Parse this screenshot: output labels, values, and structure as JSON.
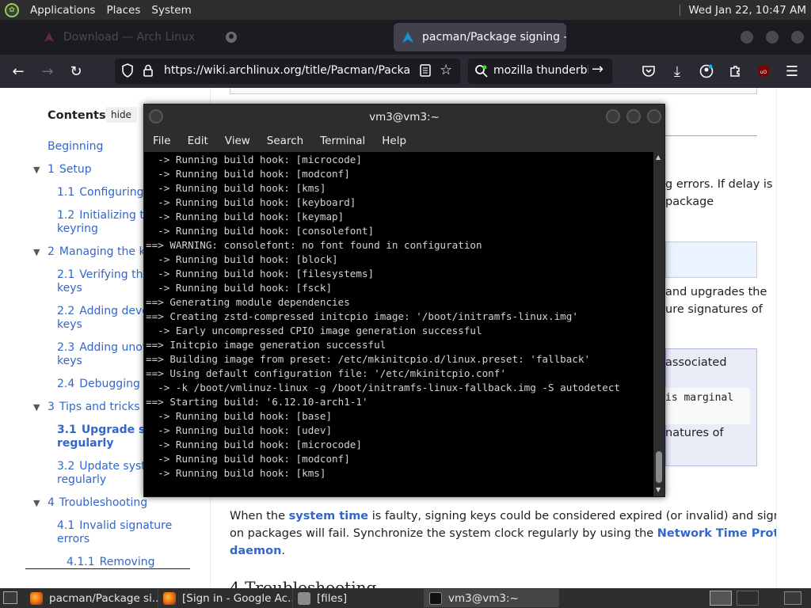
{
  "top_panel": {
    "applications": "Applications",
    "places": "Places",
    "system": "System",
    "clock": "Wed Jan 22, 10:47 AM"
  },
  "browser": {
    "tabs": [
      {
        "label": "Download — Arch Linux",
        "favicon": "arch-icon"
      },
      {
        "label": "",
        "favicon": "github-icon"
      },
      {
        "label": "pacman/Package signing - A",
        "favicon": "arch-icon",
        "active": true
      }
    ],
    "url": "https://wiki.archlinux.org/title/Pacman/Package_si",
    "search_query": "mozilla thunderbird"
  },
  "wiki": {
    "toc_title": "Contents",
    "toc_hide": "hide",
    "toc": [
      {
        "text": "Beginning"
      },
      {
        "num": "1",
        "text": "Setup"
      },
      {
        "num": "1.1",
        "text": "Configuring p"
      },
      {
        "num": "1.2",
        "text": "Initializing the",
        "text2": "keyring"
      },
      {
        "num": "2",
        "text": "Managing the key"
      },
      {
        "num": "2.1",
        "text": "Verifying the",
        "text2": "keys"
      },
      {
        "num": "2.2",
        "text": "Adding develo",
        "text2": "keys"
      },
      {
        "num": "2.3",
        "text": "Adding unoffi",
        "text2": "keys"
      },
      {
        "num": "2.4",
        "text": "Debugging w"
      },
      {
        "num": "3",
        "text": "Tips and tricks"
      },
      {
        "num": "3.1",
        "text": "Upgrade sys",
        "text2": "regularly"
      },
      {
        "num": "3.2",
        "text": "Update system",
        "text2": "regularly"
      },
      {
        "num": "4",
        "text": "Troubleshooting"
      },
      {
        "num": "4.1",
        "text": "Invalid signature",
        "text2": "errors"
      },
      {
        "num": "4.1.1",
        "text": "Removing"
      }
    ],
    "main_fragments": {
      "frag1": "g errors. If delay is",
      "frag2": "package",
      "frag3": "and upgrades the",
      "frag4": "ure signatures of",
      "frag5": "associated",
      "frag6": "is marginal",
      "frag7": "natures of"
    },
    "para_start": "When the ",
    "para_link1": "system time",
    "para_mid": " is faulty, signing keys could be considered expired (or invalid) and signature checks",
    "para_line2a": "on packages will fail. Synchronize the system clock regularly by using the ",
    "para_link2": "Network Time Protocol",
    "para_link2b": "daemon",
    "para_end": ".",
    "bottom_heading": "4 Troubleshooting"
  },
  "terminal": {
    "title": "vm3@vm3:~",
    "menu": [
      "File",
      "Edit",
      "View",
      "Search",
      "Terminal",
      "Help"
    ],
    "lines": [
      "  -> Running build hook: [microcode]",
      "  -> Running build hook: [modconf]",
      "  -> Running build hook: [kms]",
      "  -> Running build hook: [keyboard]",
      "  -> Running build hook: [keymap]",
      "  -> Running build hook: [consolefont]",
      "==> WARNING: consolefont: no font found in configuration",
      "  -> Running build hook: [block]",
      "  -> Running build hook: [filesystems]",
      "  -> Running build hook: [fsck]",
      "==> Generating module dependencies",
      "==> Creating zstd-compressed initcpio image: '/boot/initramfs-linux.img'",
      "  -> Early uncompressed CPIO image generation successful",
      "==> Initcpio image generation successful",
      "==> Building image from preset: /etc/mkinitcpio.d/linux.preset: 'fallback'",
      "==> Using default configuration file: '/etc/mkinitcpio.conf'",
      "  -> -k /boot/vmlinuz-linux -g /boot/initramfs-linux-fallback.img -S autodetect",
      "==> Starting build: '6.12.10-arch1-1'",
      "  -> Running build hook: [base]",
      "  -> Running build hook: [udev]",
      "  -> Running build hook: [microcode]",
      "  -> Running build hook: [modconf]",
      "  -> Running build hook: [kms]"
    ]
  },
  "taskbar": {
    "items": [
      {
        "label": "pacman/Package si..."
      },
      {
        "label": "[Sign in - Google Ac..."
      },
      {
        "label": "[files]"
      },
      {
        "label": "vm3@vm3:~"
      }
    ]
  },
  "colors": {
    "panel": "#2e2e2e",
    "firefox_tabstrip": "#1c1b22",
    "firefox_navbar": "#2b2a33",
    "wiki_link": "#3366cc",
    "terminal_bg": "#000000",
    "terminal_fg": "#d3d3d3"
  }
}
